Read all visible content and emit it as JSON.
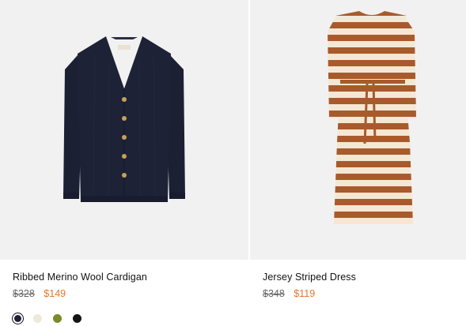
{
  "products": [
    {
      "name": "Ribbed Merino Wool Cardigan",
      "original_price": "$328",
      "sale_price": "$149",
      "swatches": [
        {
          "color": "#1c2233",
          "selected": true
        },
        {
          "color": "#efe9da",
          "selected": false
        },
        {
          "color": "#7a8a28",
          "selected": false
        },
        {
          "color": "#151515",
          "selected": false
        }
      ]
    },
    {
      "name": "Jersey Striped Dress",
      "original_price": "$348",
      "sale_price": "$119"
    }
  ],
  "colors": {
    "sale_price": "#e5762d",
    "image_background": "#f1f1f1",
    "cardigan": "#1a1f33",
    "stripe_brown": "#a95a2c",
    "stripe_cream": "#f4e8d4"
  }
}
